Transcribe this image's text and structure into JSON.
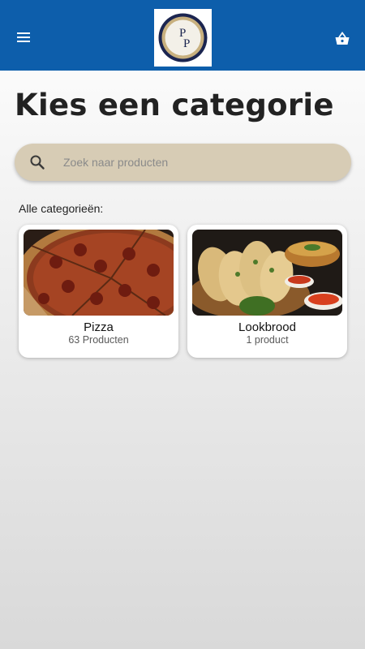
{
  "header": {
    "menu_icon": "menu-icon",
    "logo_icon": "pizza-logo",
    "logo_text": [
      "P",
      "P"
    ],
    "cart_icon": "shopping-basket-icon",
    "bar_color": "#0d5eab"
  },
  "main": {
    "title": "Kies een categorie",
    "search": {
      "icon": "search-icon",
      "placeholder": "Zoek naar producten",
      "value": "",
      "background": "#d7ccb5"
    },
    "section_label": "Alle categorieën:",
    "categories": [
      {
        "name": "Pizza",
        "count": "63 Producten",
        "image_icon": "pizza-photo"
      },
      {
        "name": "Lookbrood",
        "count": "1 product",
        "image_icon": "garlic-bread-photo"
      }
    ]
  }
}
